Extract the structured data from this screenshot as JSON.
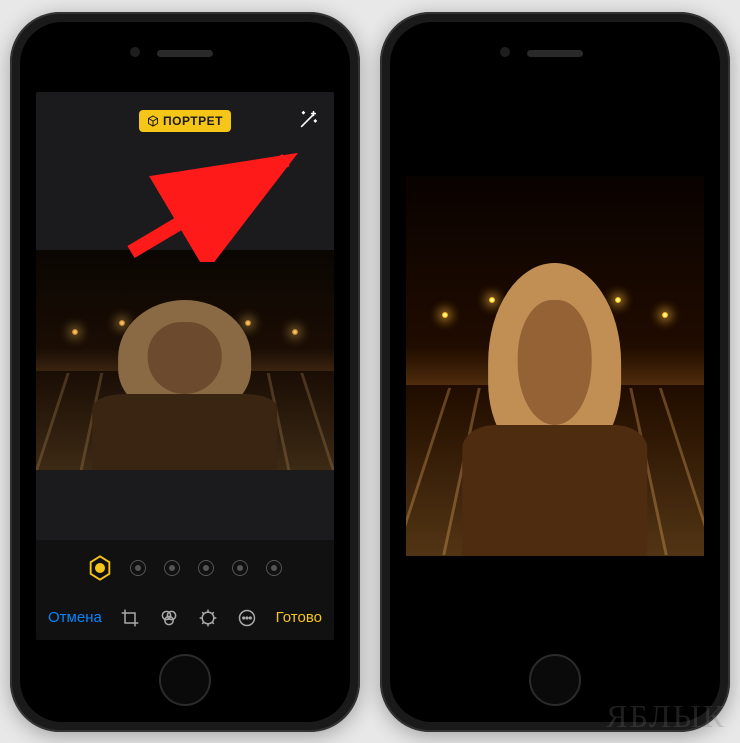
{
  "left_phone": {
    "badge": {
      "label": "ПОРТРЕТ",
      "icon": "cube-icon"
    },
    "wand_icon": "magic-wand-icon",
    "annotation_arrow": "arrow-to-wand",
    "bottom": {
      "cancel": "Отмена",
      "done": "Готово",
      "tools": {
        "crop": "crop-icon",
        "filters": "filters-icon",
        "adjust": "adjust-icon",
        "more": "more-icon"
      }
    },
    "adjust_dots_count": 5
  },
  "watermark": "ЯБЛЫК"
}
